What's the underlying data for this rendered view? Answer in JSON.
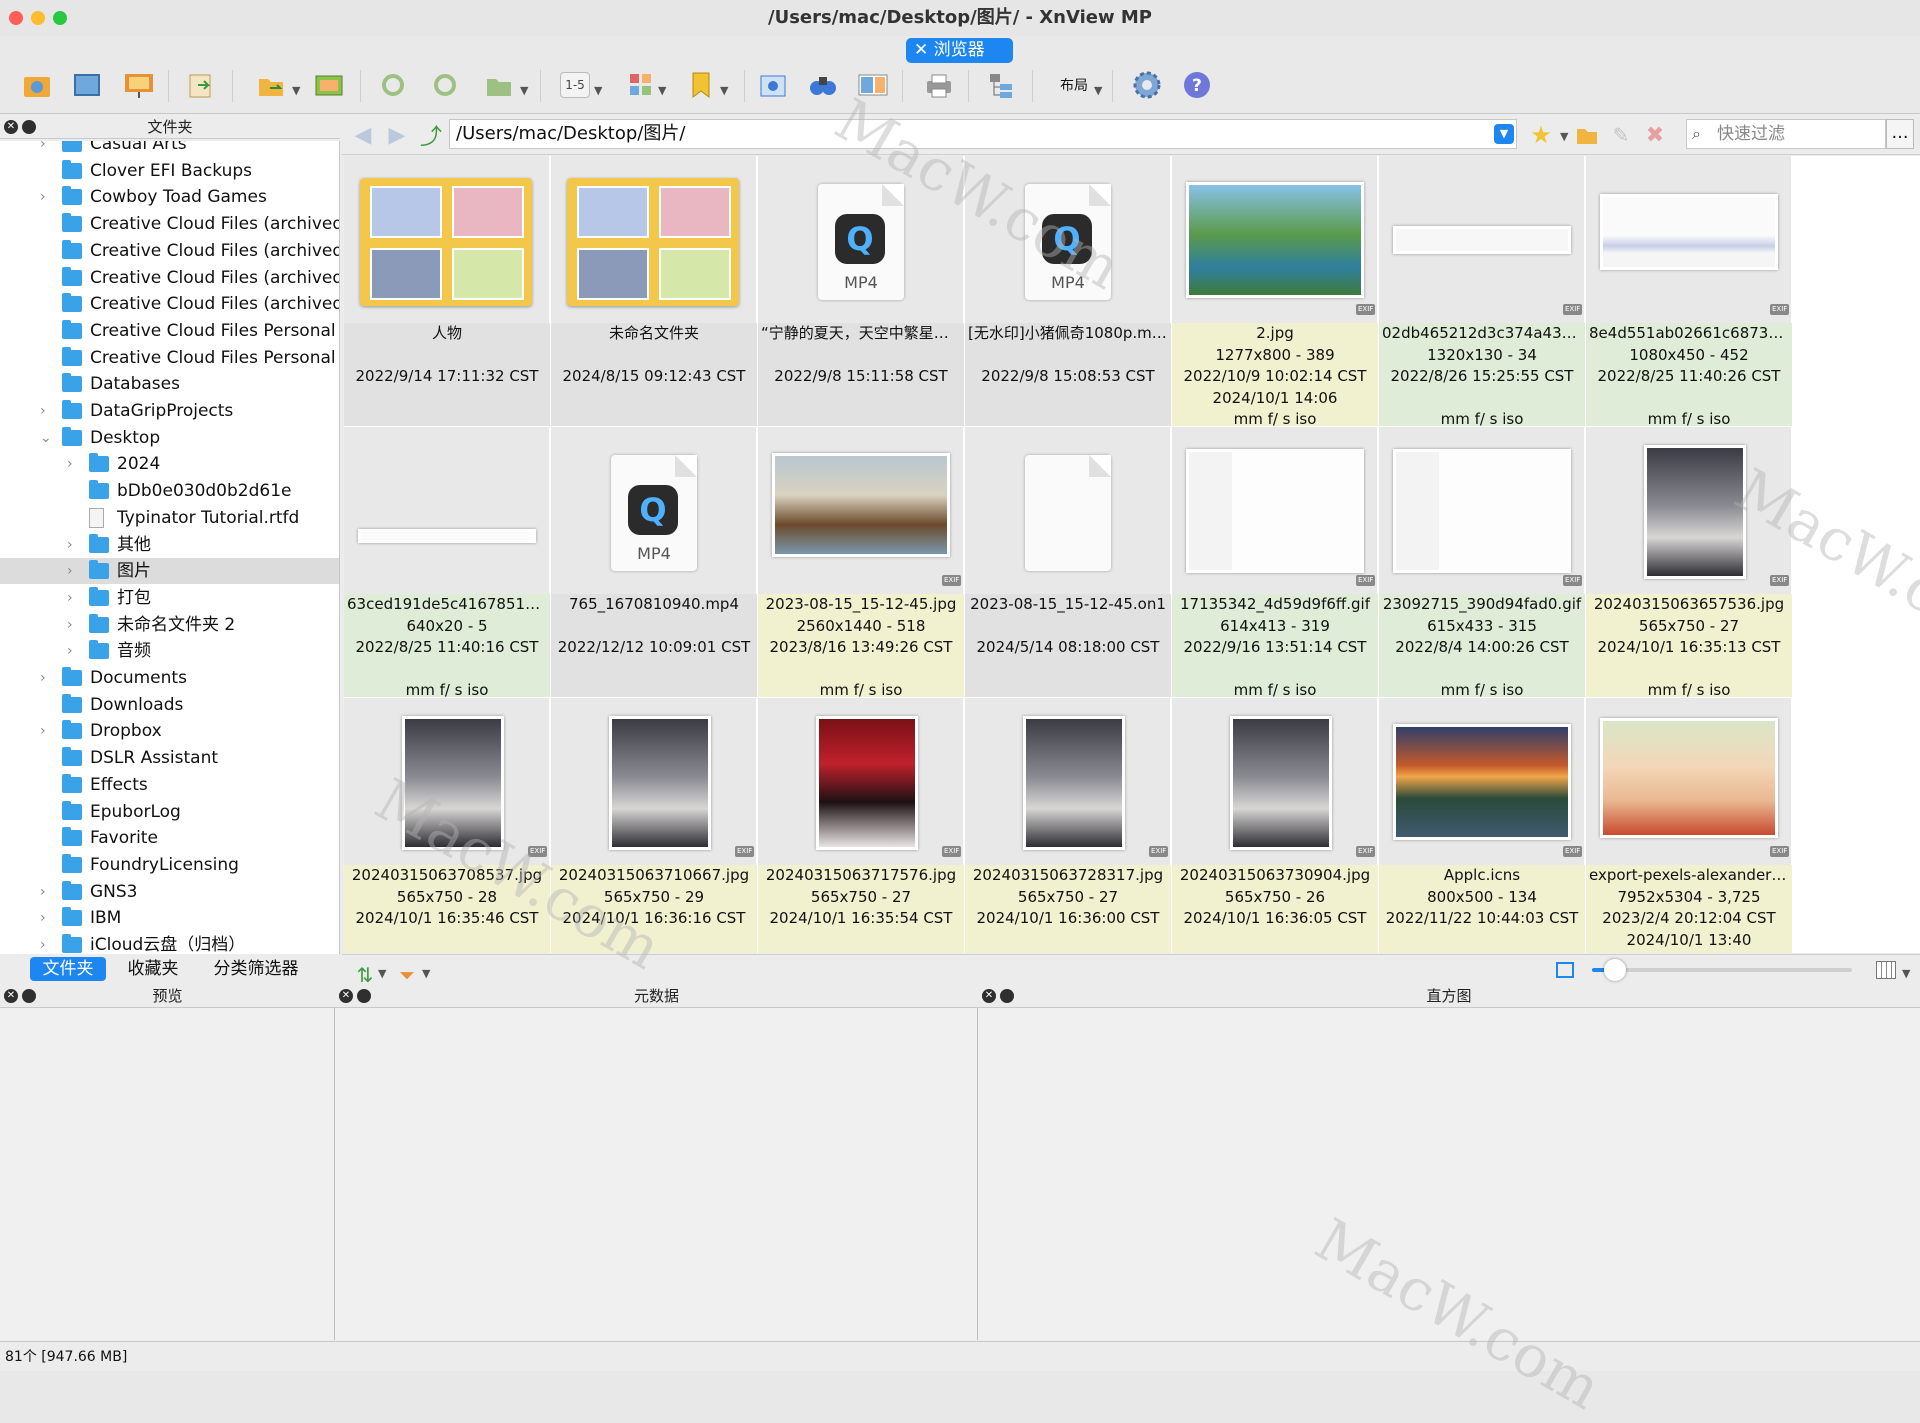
{
  "window": {
    "title": "/Users/mac/Desktop/图片/ - XnView MP"
  },
  "tab": {
    "label": "浏览器"
  },
  "toolbar": {
    "layout_label": "布局",
    "page_range": "1-5"
  },
  "panels": {
    "folders_title": "文件夹",
    "preview_title": "预览",
    "metadata_title": "元数据",
    "histogram_title": "直方图"
  },
  "path": {
    "value": "/Users/mac/Desktop/图片/",
    "filter_placeholder": "快速过滤"
  },
  "tree": [
    {
      "label": "Casual Arts",
      "indent": 0,
      "expand": true,
      "type": "folder"
    },
    {
      "label": "Clover EFI Backups",
      "indent": 0,
      "expand": false,
      "type": "folder"
    },
    {
      "label": "Cowboy Toad Games",
      "indent": 0,
      "expand": true,
      "type": "folder"
    },
    {
      "label": "Creative Cloud Files (archived)",
      "indent": 0,
      "expand": false,
      "type": "folder"
    },
    {
      "label": "Creative Cloud Files (archived)",
      "indent": 0,
      "expand": false,
      "type": "folder"
    },
    {
      "label": "Creative Cloud Files (archived)",
      "indent": 0,
      "expand": false,
      "type": "folder"
    },
    {
      "label": "Creative Cloud Files (archived)",
      "indent": 0,
      "expand": false,
      "type": "folder"
    },
    {
      "label": "Creative Cloud Files Personal Ac",
      "indent": 0,
      "expand": false,
      "type": "folder"
    },
    {
      "label": "Creative Cloud Files Personal Ac",
      "indent": 0,
      "expand": false,
      "type": "folder"
    },
    {
      "label": "Databases",
      "indent": 0,
      "expand": false,
      "type": "folder"
    },
    {
      "label": "DataGripProjects",
      "indent": 0,
      "expand": true,
      "type": "folder"
    },
    {
      "label": "Desktop",
      "indent": 0,
      "expand": "open",
      "type": "folder"
    },
    {
      "label": "2024",
      "indent": 1,
      "expand": true,
      "type": "folder"
    },
    {
      "label": "bDb0e030d0b2d61e",
      "indent": 1,
      "expand": false,
      "type": "folder"
    },
    {
      "label": "Typinator Tutorial.rtfd",
      "indent": 1,
      "expand": false,
      "type": "doc"
    },
    {
      "label": "其他",
      "indent": 1,
      "expand": true,
      "type": "folder"
    },
    {
      "label": "图片",
      "indent": 1,
      "expand": true,
      "type": "folder",
      "selected": true
    },
    {
      "label": "打包",
      "indent": 1,
      "expand": true,
      "type": "folder"
    },
    {
      "label": "未命名文件夹 2",
      "indent": 1,
      "expand": true,
      "type": "folder"
    },
    {
      "label": "音频",
      "indent": 1,
      "expand": true,
      "type": "folder"
    },
    {
      "label": "Documents",
      "indent": 0,
      "expand": true,
      "type": "folder"
    },
    {
      "label": "Downloads",
      "indent": 0,
      "expand": false,
      "type": "folder"
    },
    {
      "label": "Dropbox",
      "indent": 0,
      "expand": true,
      "type": "folder"
    },
    {
      "label": "DSLR Assistant",
      "indent": 0,
      "expand": false,
      "type": "folder"
    },
    {
      "label": "Effects",
      "indent": 0,
      "expand": false,
      "type": "folder"
    },
    {
      "label": "EpuborLog",
      "indent": 0,
      "expand": false,
      "type": "folder"
    },
    {
      "label": "Favorite",
      "indent": 0,
      "expand": false,
      "type": "folder"
    },
    {
      "label": "FoundryLicensing",
      "indent": 0,
      "expand": false,
      "type": "folder"
    },
    {
      "label": "GNS3",
      "indent": 0,
      "expand": true,
      "type": "folder"
    },
    {
      "label": "IBM",
      "indent": 0,
      "expand": true,
      "type": "folder"
    },
    {
      "label": "iCloud云盘（归档）",
      "indent": 0,
      "expand": true,
      "type": "folder"
    }
  ],
  "tree_tabs": [
    "文件夹",
    "收藏夹",
    "分类筛选器"
  ],
  "files": [
    {
      "kind": "folder",
      "bg": "grey",
      "lines": [
        "人物",
        "",
        "2022/9/14 17:11:32 CST",
        "",
        ""
      ]
    },
    {
      "kind": "folder",
      "bg": "grey",
      "lines": [
        "未命名文件夹",
        "",
        "2024/8/15 09:12:43 CST",
        "",
        ""
      ]
    },
    {
      "kind": "mp4",
      "bg": "grey",
      "lines": [
        "“宁静的夏天，天空中繁星点点...",
        "",
        "2022/9/8 15:11:58 CST",
        "",
        ""
      ]
    },
    {
      "kind": "mp4",
      "bg": "grey",
      "lines": [
        "[无水印]小猪佩奇1080p.mp4",
        "",
        "2022/9/8 15:08:53 CST",
        "",
        ""
      ]
    },
    {
      "kind": "landscape",
      "bg": "yellow",
      "lines": [
        "2.jpg",
        "1277x800 - 389",
        "2022/10/9 10:02:14 CST",
        "2024/10/1 14:06",
        "mm f/ s iso"
      ]
    },
    {
      "kind": "strip",
      "bg": "green",
      "lines": [
        "02db465212d3c374a43c6...",
        "1320x130 - 34",
        "2022/8/26 15:25:55 CST",
        "",
        "mm f/ s iso"
      ]
    },
    {
      "kind": "wide",
      "bg": "green",
      "lines": [
        "8e4d551ab02661c687333...",
        "1080x450 - 452",
        "2022/8/25 11:40:26 CST",
        "",
        "mm f/ s iso"
      ]
    },
    {
      "kind": "bar",
      "bg": "green",
      "lines": [
        "63ced191de5c416785113...",
        "640x20 - 5",
        "2022/8/25 11:40:16 CST",
        "",
        "mm f/ s iso"
      ]
    },
    {
      "kind": "mp4",
      "bg": "grey",
      "lines": [
        "765_1670810940.mp4",
        "",
        "2022/12/12 10:09:01 CST",
        "",
        ""
      ]
    },
    {
      "kind": "ships",
      "bg": "yellow",
      "lines": [
        "2023-08-15_15-12-45.jpg",
        "2560x1440 - 518",
        "2023/8/16 13:49:26 CST",
        "",
        "mm f/ s iso"
      ]
    },
    {
      "kind": "blank",
      "bg": "grey",
      "lines": [
        "2023-08-15_15-12-45.on1",
        "",
        "2024/5/14 08:18:00 CST",
        "",
        ""
      ]
    },
    {
      "kind": "shot",
      "bg": "green",
      "lines": [
        "17135342_4d59d9f6ff.gif",
        "614x413 - 319",
        "2022/9/16 13:51:14 CST",
        "",
        "mm f/ s iso"
      ]
    },
    {
      "kind": "shot",
      "bg": "green",
      "lines": [
        "23092715_390d94fad0.gif",
        "615x433 - 315",
        "2022/8/4 14:00:26 CST",
        "",
        "mm f/ s iso"
      ]
    },
    {
      "kind": "portrait",
      "bg": "yellow",
      "lines": [
        "20240315063657536.jpg",
        "565x750 - 27",
        "2024/10/1 16:35:13 CST",
        "",
        "mm f/ s iso"
      ]
    },
    {
      "kind": "portrait",
      "bg": "yellow",
      "lines": [
        "20240315063708537.jpg",
        "565x750 - 28",
        "2024/10/1 16:35:46 CST",
        "",
        ""
      ]
    },
    {
      "kind": "portrait",
      "bg": "yellow",
      "lines": [
        "20240315063710667.jpg",
        "565x750 - 29",
        "2024/10/1 16:36:16 CST",
        "",
        ""
      ]
    },
    {
      "kind": "portrait-red",
      "bg": "yellow",
      "lines": [
        "20240315063717576.jpg",
        "565x750 - 27",
        "2024/10/1 16:35:54 CST",
        "",
        ""
      ]
    },
    {
      "kind": "portrait",
      "bg": "yellow",
      "lines": [
        "20240315063728317.jpg",
        "565x750 - 27",
        "2024/10/1 16:36:00 CST",
        "",
        ""
      ]
    },
    {
      "kind": "portrait",
      "bg": "yellow",
      "lines": [
        "20240315063730904.jpg",
        "565x750 - 26",
        "2024/10/1 16:36:05 CST",
        "",
        ""
      ]
    },
    {
      "kind": "sunset",
      "bg": "yellow",
      "lines": [
        "Applc.icns",
        "800x500 - 134",
        "2022/11/22 10:44:03 CST",
        "",
        ""
      ]
    },
    {
      "kind": "child",
      "bg": "yellow",
      "lines": [
        "export-pexels-alexander dum...",
        "7952x5304 - 3,725",
        "2023/2/4 20:12:04 CST",
        "2024/10/1 13:40",
        ""
      ]
    }
  ],
  "status": {
    "text": "81个 [947.66 MB]"
  },
  "watermark": "MacW.com",
  "colors": {
    "accent": "#1e86f0",
    "folder": "#3aa2e8",
    "yellow_info": "#f1f0cf",
    "green_info": "#deecd8"
  }
}
